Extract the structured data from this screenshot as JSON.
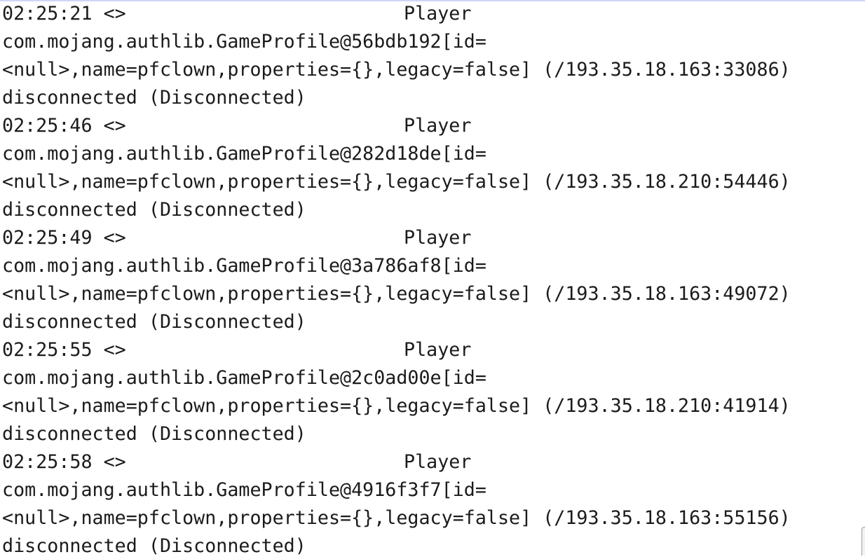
{
  "log": {
    "entries": [
      {
        "time_prefix": "02:25:21 <>",
        "event": "Player",
        "profile": "com.mojang.authlib.GameProfile@56bdb192[id=",
        "details": "<null>,name=pfclown,properties={},legacy=false] (/193.35.18.163:33086)",
        "status": "disconnected (Disconnected)"
      },
      {
        "time_prefix": "02:25:46 <>",
        "event": "Player",
        "profile": "com.mojang.authlib.GameProfile@282d18de[id=",
        "details": "<null>,name=pfclown,properties={},legacy=false] (/193.35.18.210:54446)",
        "status": "disconnected (Disconnected)"
      },
      {
        "time_prefix": "02:25:49 <>",
        "event": "Player",
        "profile": "com.mojang.authlib.GameProfile@3a786af8[id=",
        "details": "<null>,name=pfclown,properties={},legacy=false] (/193.35.18.163:49072)",
        "status": "disconnected (Disconnected)"
      },
      {
        "time_prefix": "02:25:55 <>",
        "event": "Player",
        "profile": "com.mojang.authlib.GameProfile@2c0ad00e[id=",
        "details": "<null>,name=pfclown,properties={},legacy=false] (/193.35.18.210:41914)",
        "status": "disconnected (Disconnected)"
      },
      {
        "time_prefix": "02:25:58 <>",
        "event": "Player",
        "profile": "com.mojang.authlib.GameProfile@4916f3f7[id=",
        "details": "<null>,name=pfclown,properties={},legacy=false] (/193.35.18.163:55156)",
        "status": "disconnected (Disconnected)"
      }
    ]
  },
  "colors": {
    "text": "#1b1b1b",
    "background": "#ffffff",
    "top_rule": "#cfd6f7"
  }
}
